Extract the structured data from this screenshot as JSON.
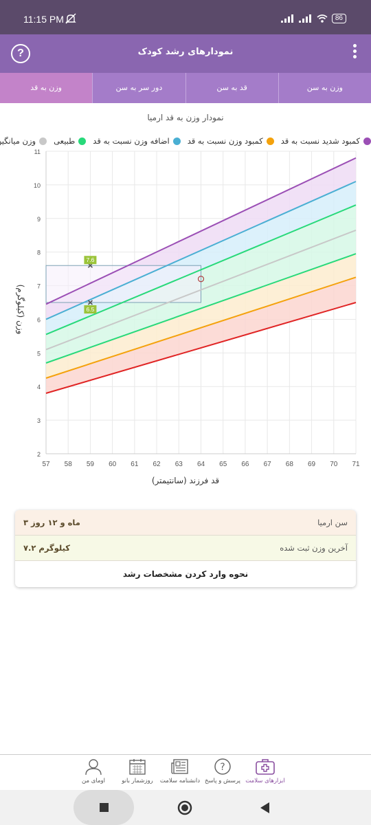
{
  "status_bar": {
    "time": "11:15 PM",
    "battery": "86"
  },
  "header": {
    "title": "نمودارهای رشد کودک",
    "help_symbol": "?"
  },
  "tabs": [
    {
      "label": "وزن به سن",
      "active": false
    },
    {
      "label": "قد به سن",
      "active": false
    },
    {
      "label": "دور سر به سن",
      "active": false
    },
    {
      "label": "وزن به قد",
      "active": true
    }
  ],
  "chart_data": {
    "type": "line",
    "title": "نمودار وزن به قد ارمیا",
    "xlabel": "قد فرزند (سانتیمتر)",
    "ylabel": "وزن (کیلوگرم)",
    "xlim": [
      57,
      71
    ],
    "ylim": [
      2,
      11
    ],
    "x_ticks": [
      "57",
      "58",
      "59",
      "60",
      "61",
      "62",
      "63",
      "64",
      "65",
      "66",
      "67",
      "68",
      "69",
      "70",
      "71"
    ],
    "y_ticks": [
      "2",
      "3",
      "4",
      "5",
      "6",
      "7",
      "8",
      "9",
      "10",
      "11"
    ],
    "grid": true,
    "legend_position": "top",
    "x": [
      57,
      71
    ],
    "series": [
      {
        "name": "کمبود شدید نسبت به قد",
        "color": "#9b4fb5",
        "values": [
          6.45,
          10.8
        ]
      },
      {
        "name": "اضافه وزن نسبت به قد",
        "color": "#4aafd3",
        "values": [
          6.0,
          10.1
        ]
      },
      {
        "name": "طبیعی",
        "color": "#28d97a",
        "values": [
          5.55,
          9.4
        ]
      },
      {
        "name": "وزن میانگین",
        "color": "#c8c8c8",
        "values": [
          5.1,
          8.65
        ]
      },
      {
        "name": "طبیعی",
        "color": "#28d97a",
        "values": [
          4.7,
          7.95
        ]
      },
      {
        "name": "کمبود وزن نسبت به قد",
        "color": "#f4a20c",
        "values": [
          4.25,
          7.25
        ]
      },
      {
        "name": "کمبود شدید نسبت به قد",
        "color": "#e02424",
        "values": [
          3.8,
          6.5
        ]
      }
    ],
    "legend": [
      {
        "label": "کمبود شدید نسبت به قد",
        "color": "#9b4fb5"
      },
      {
        "label": "کمبود وزن نسبت به قد",
        "color": "#f4a20c"
      },
      {
        "label": "اضافه وزن نسبت به قد",
        "color": "#4aafd3"
      },
      {
        "label": "طبیعی",
        "color": "#28d97a"
      },
      {
        "label": "وزن میانگین",
        "color": "#c8c8c8"
      }
    ],
    "markers": [
      {
        "x": 59,
        "y": 7.6,
        "label": "7.6"
      },
      {
        "x": 59,
        "y": 6.5,
        "label": "6.5"
      }
    ],
    "highlight_range": {
      "x": [
        57,
        64
      ],
      "y": [
        6.5,
        7.6
      ]
    },
    "child_point": {
      "x": 64,
      "y": 7.2
    }
  },
  "info": {
    "age_label": "سن ارمیا",
    "age_value": "۳ ماه و ۱۲ روز",
    "weight_label": "آخرین وزن ثبت شده",
    "weight_value": "۷.۲ کیلوگرم",
    "guide_link": "نحوه وارد کردن مشخصات رشد"
  },
  "bottom_nav": [
    {
      "label": "ابزارهای سلامت",
      "icon": "health-kit-icon",
      "active": true
    },
    {
      "label": "پرسش و پاسخ",
      "icon": "question-icon",
      "active": false
    },
    {
      "label": "دانشنامه سلامت",
      "icon": "newspaper-icon",
      "active": false
    },
    {
      "label": "روزشمار بانو",
      "icon": "calendar-icon",
      "active": false
    },
    {
      "label": "اومای من",
      "icon": "profile-icon",
      "active": false
    }
  ]
}
